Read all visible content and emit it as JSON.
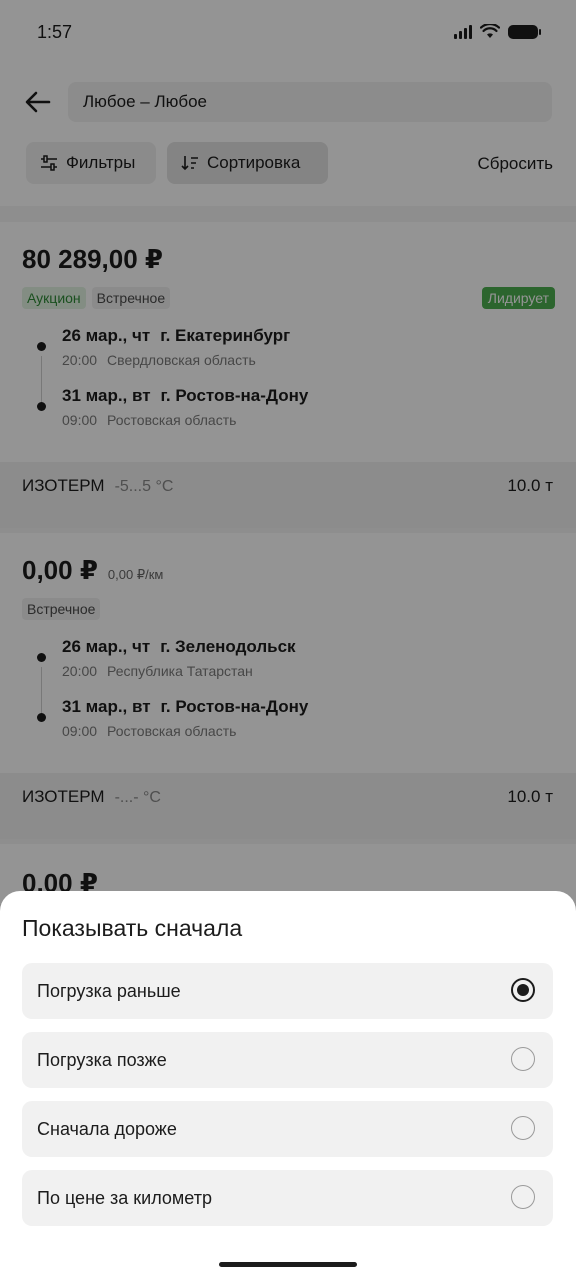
{
  "status_bar": {
    "time": "1:57"
  },
  "header": {
    "route": "Любое – Любое",
    "filters_label": "Фильтры",
    "sort_label": "Сортировка",
    "reset_label": "Сбросить"
  },
  "orders": [
    {
      "price": "80 289,00 ₽",
      "tags": [
        "Аукцион",
        "Встречное"
      ],
      "badge": "Лидирует",
      "stops": [
        {
          "date": "26 мар., чт",
          "city": "г. Екатеринбург",
          "time": "20:00",
          "region": "Свердловская область"
        },
        {
          "date": "31 мар., вт",
          "city": "г. Ростов-на-Дону",
          "time": "09:00",
          "region": "Ростовская область"
        }
      ],
      "cargo": {
        "type": "ИЗОТЕРМ",
        "temp": "-5...5 °C",
        "weight": "10.0 т"
      }
    },
    {
      "price": "0,00 ₽",
      "per_km": "0,00 ₽/км",
      "tags": [
        "Встречное"
      ],
      "stops": [
        {
          "date": "26 мар., чт",
          "city": "г. Зеленодольск",
          "time": "20:00",
          "region": "Республика Татарстан"
        },
        {
          "date": "31 мар., вт",
          "city": "г. Ростов-на-Дону",
          "time": "09:00",
          "region": "Ростовская область"
        }
      ],
      "cargo": {
        "type": "ИЗОТЕРМ",
        "temp": "-...- °C",
        "weight": "10.0 т"
      }
    },
    {
      "price": "0,00 ₽"
    }
  ],
  "sort_sheet": {
    "title": "Показывать сначала",
    "options": [
      {
        "label": "Погрузка раньше",
        "selected": true
      },
      {
        "label": "Погрузка позже",
        "selected": false
      },
      {
        "label": "Сначала дороже",
        "selected": false
      },
      {
        "label": "По цене за километр",
        "selected": false
      }
    ]
  },
  "icons": {
    "back": "arrow-left-icon",
    "filters": "sliders-icon",
    "sort": "sort-descending-icon",
    "signal": "cellular-signal-icon",
    "wifi": "wifi-icon",
    "battery": "battery-icon"
  },
  "colors": {
    "accent_green": "#4caf50",
    "auction_text": "#2e8b36"
  }
}
